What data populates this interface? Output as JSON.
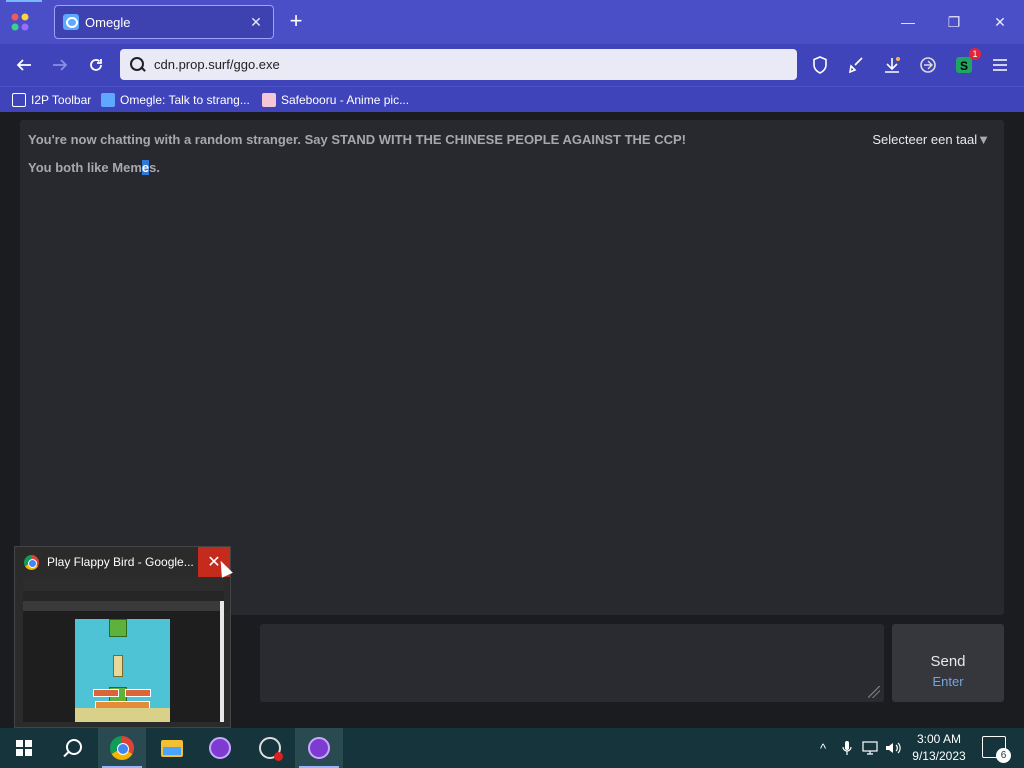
{
  "browser": {
    "tab": {
      "title": "Omegle",
      "close": "✕"
    },
    "new_tab": "+",
    "window_controls": {
      "minimize": "—",
      "restore": "❐",
      "close": "✕"
    },
    "address": "cdn.prop.surf/ggo.exe",
    "extension_badge": "1",
    "bookmarks": [
      {
        "label": "I2P Toolbar",
        "icon": "folder-icon"
      },
      {
        "label": "Omegle: Talk to strang...",
        "icon": "omegle-icon"
      },
      {
        "label": "Safebooru - Anime pic...",
        "icon": "safebooru-icon"
      }
    ]
  },
  "chat": {
    "status_line": "You're now chatting with a random stranger. Say STAND WITH THE CHINESE PEOPLE AGAINST THE CCP!",
    "likes_prefix": "You both like Mem",
    "likes_highlight": "e",
    "likes_suffix": "s.",
    "language_select": "Selecteer een taal",
    "language_arrow": "▼",
    "message_value": "",
    "send_label": "Send",
    "send_hint": "Enter"
  },
  "thumbnail": {
    "title": "Play Flappy Bird - Google...",
    "close": "✕"
  },
  "taskbar": {
    "tray_chevron": "^",
    "time": "3:00 AM",
    "date": "9/13/2023",
    "notification_count": "6"
  },
  "colors": {
    "browser_accent": "#4a4fc8",
    "page_bg": "#1b1c20",
    "chat_bg": "#28292e",
    "selection": "#2f78d8",
    "taskbar_bg": "#15343c",
    "close_red": "#c42b1c"
  }
}
